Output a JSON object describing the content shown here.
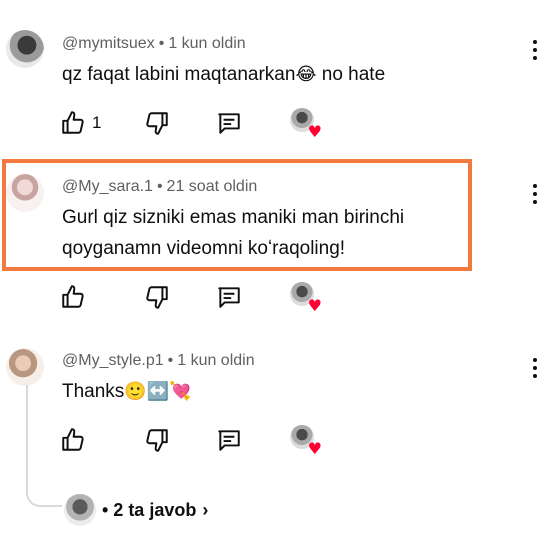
{
  "comments": [
    {
      "author": "@mymitsuex",
      "time": "1 kun oldin",
      "text": "qz faqat labini maqtanarkan",
      "emoji": "😂",
      "text_after": " no hate",
      "likes": "1"
    },
    {
      "author": "@My_sara.1",
      "time": "21 soat oldin",
      "text_line1": "Gurl qiz sizniki emas maniki man birinchi",
      "text_line2": "qoyganamn videomni koʻraqoling!",
      "likes": ""
    },
    {
      "author": "@My_style.p1",
      "time": "1 kun oldin",
      "text": "Thanks",
      "emoji": "🙂↔️💘",
      "likes": ""
    }
  ],
  "replies": {
    "label": "• 2 ta javob",
    "chevron": "›"
  },
  "icons": {
    "like": "thumb-up-icon",
    "dislike": "thumb-down-icon",
    "reply": "comment-icon",
    "more": "more-vert-icon",
    "creator_heart": "creator-heart-icon"
  },
  "colors": {
    "highlight": "#f27a41",
    "heart": "#ff0033",
    "meta": "#606060"
  }
}
